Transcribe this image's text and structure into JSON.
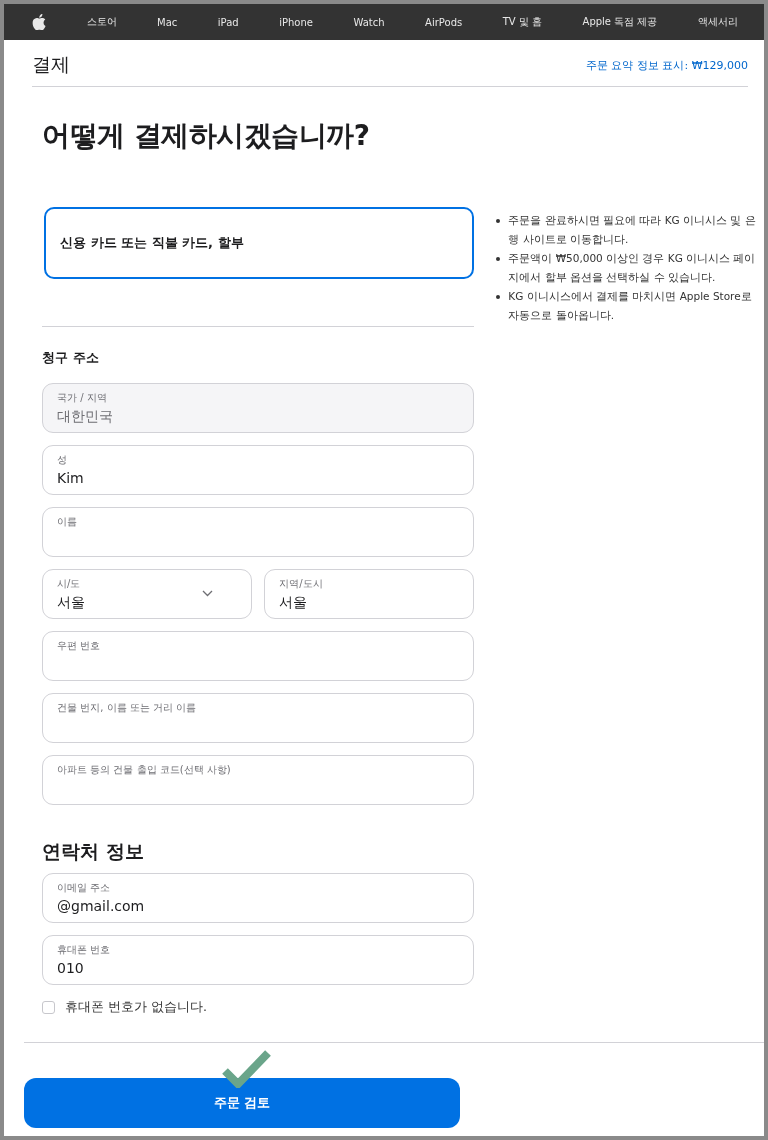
{
  "nav": {
    "items": [
      "스토어",
      "Mac",
      "iPad",
      "iPhone",
      "Watch",
      "AirPods",
      "TV 및 홈",
      "Apple 독점 제공",
      "액세서리"
    ]
  },
  "header": {
    "title": "결제",
    "summary_link": "주문 요약 정보 표시: ₩129,000"
  },
  "heading": "어떻게 결제하시겠습니까?",
  "payment_options": [
    {
      "label": "신용 카드 또는 직불 카드, 할부",
      "selected": true
    }
  ],
  "notes": [
    "주문을 완료하시면 필요에 따라 KG 이니시스 및 은행 사이트로 이동합니다.",
    "주문액이 ₩50,000 이상인 경우 KG 이니시스 페이지에서 할부 옵션을 선택하실 수 있습니다.",
    "KG 이니시스에서 결제를 마치시면 Apple Store로 자동으로 돌아옵니다."
  ],
  "billing": {
    "title": "청구 주소",
    "rows": [
      [
        {
          "kind": "input",
          "label": "국가 / 지역",
          "value": "대한민국",
          "disabled": true
        }
      ],
      [
        {
          "kind": "input",
          "label": "성",
          "value": "Kim"
        }
      ],
      [
        {
          "kind": "input",
          "label": "이름"
        }
      ],
      [
        {
          "kind": "select",
          "label": "시/도",
          "value": "서울"
        },
        {
          "kind": "input",
          "label": "지역/도시",
          "value": "서울"
        }
      ],
      [
        {
          "kind": "input",
          "label": "우편 번호"
        }
      ],
      [
        {
          "kind": "input",
          "label": "건물 번지, 이름 또는 거리 이름"
        }
      ],
      [
        {
          "kind": "input",
          "label": "아파트 등의 건물 출입 코드(선택 사항)"
        }
      ]
    ]
  },
  "contact": {
    "title": "연락처 정보",
    "fields": [
      {
        "kind": "input",
        "label": "이메일 주소",
        "value": "@gmail.com"
      },
      {
        "kind": "input",
        "label": "휴대폰 번호",
        "value": "010"
      }
    ],
    "no_phone": {
      "label": "휴대폰 번호가 없습니다.",
      "checked": false
    }
  },
  "review_button": {
    "label": "주문 검토"
  }
}
